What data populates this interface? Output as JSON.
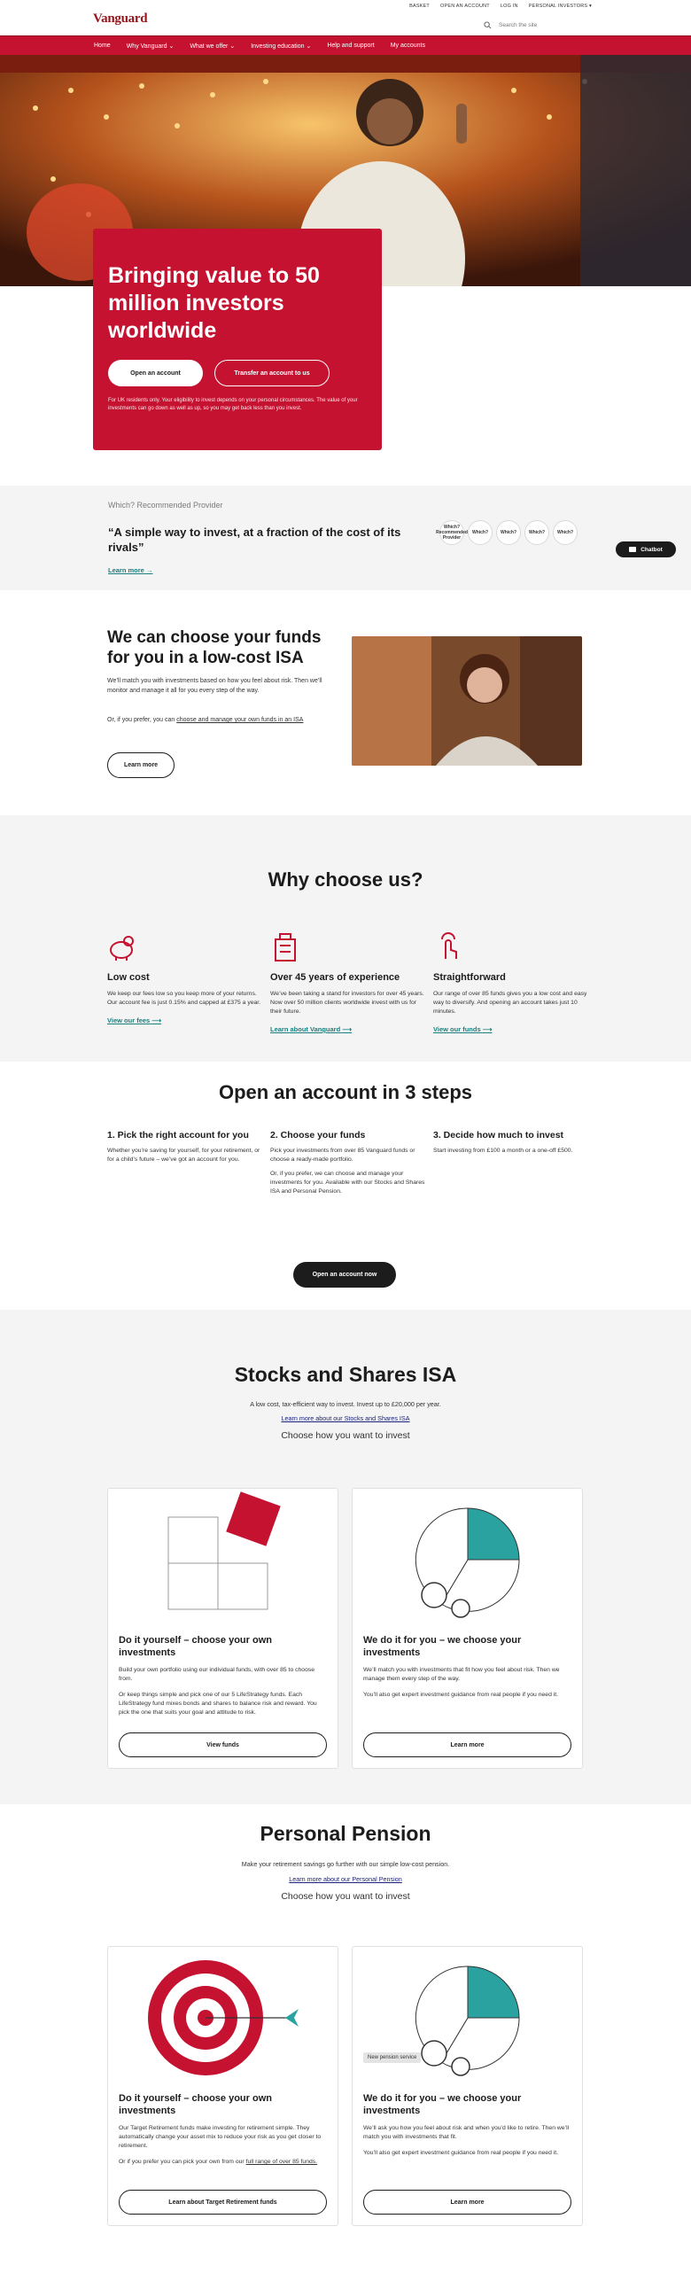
{
  "header": {
    "logo": "Vanguard",
    "top_links": [
      "Basket",
      "Open an account",
      "Log in",
      "Personal investors"
    ],
    "search_placeholder": "Search the site"
  },
  "nav": {
    "items": [
      "Home",
      "Why Vanguard",
      "What we offer",
      "Investing education",
      "Help and support",
      "My accounts"
    ]
  },
  "hero": {
    "title": "Bringing value to 50 million investors worldwide",
    "primary_button": "Open an account",
    "secondary_button": "Transfer an account to us",
    "disclaimer": "For UK residents only. Your eligibility to invest depends on your personal circumstances. The value of your investments can go down as well as up, so you may get back less than you invest."
  },
  "which": {
    "pre": "Which? Recommended Provider",
    "quote": "“A simple way to invest, at a fraction of the cost of its rivals”",
    "link": "Learn more",
    "badges": [
      "Which? Recommended Provider",
      "Which?",
      "Which?",
      "Which?",
      "Which?"
    ]
  },
  "chatbot": {
    "label": "Chatbot"
  },
  "isa": {
    "title": "We can choose your funds for you in a low-cost ISA",
    "p1": "We’ll match you with investments based on how you feel about risk. Then we’ll monitor and manage it all for you every step of the way.",
    "p2_prefix": "Or, if you prefer, you can ",
    "p2_link": "choose and manage your own funds in an ISA",
    "button": "Learn more"
  },
  "why": {
    "title": "Why choose us?",
    "cols": [
      {
        "title": "Low cost",
        "text": "We keep our fees low so you keep more of your returns. Our account fee is just 0.15% and capped at £375 a year.",
        "link": "View our fees"
      },
      {
        "title": "Over 45 years of experience",
        "text": "We’ve been taking a stand for investors for over 45 years. Now over 50 million clients worldwide invest with us for their future.",
        "link": "Learn about Vanguard"
      },
      {
        "title": "Straightforward",
        "text": "Our range of over 85 funds gives you a low cost and easy way to diversify. And opening an account takes just 10 minutes.",
        "link": "View our funds"
      }
    ]
  },
  "steps": {
    "title": "Open an account in 3 steps",
    "items": [
      {
        "title": "1. Pick the right account for you",
        "text": "Whether you’re saving for yourself, for your retirement, or for a child’s future – we’ve got an account for you.",
        "text2": ""
      },
      {
        "title": "2. Choose your funds",
        "text": "Pick your investments from over 85 Vanguard funds or choose a ready-made portfolio.",
        "text2": "Or, if you prefer, we can choose and manage your investments for you. Available with our Stocks and Shares ISA and Personal Pension."
      },
      {
        "title": "3. Decide how much to invest",
        "text": "Start investing from £100 a month or a one-off £500.",
        "text2": ""
      }
    ],
    "button": "Open an account now"
  },
  "stocks_isa": {
    "title": "Stocks and Shares ISA",
    "sub": "A low cost, tax-efficient way to invest. Invest up to £20,000 per year.",
    "link": "Learn more about our Stocks and Shares ISA",
    "choose": "Choose how you want to invest",
    "card1": {
      "title": "Do it yourself – choose your own investments",
      "p1": "Build your own portfolio using our individual funds, with over 85 to choose from.",
      "p2": "Or keep things simple and pick one of our 5 LifeStrategy funds. Each LifeStrategy fund mixes bonds and shares to balance risk and reward. You pick the one that suits your goal and attitude to risk.",
      "button": "View funds"
    },
    "card2": {
      "title": "We do it for you – we choose your investments",
      "p1": "We’ll match you with investments that fit how you feel about risk. Then we manage them every step of the way.",
      "p2": "You’ll also get expert investment guidance from real people if you need it.",
      "button": "Learn more"
    }
  },
  "pension": {
    "title": "Personal Pension",
    "sub": "Make your retirement savings go further with our simple low-cost pension.",
    "link": "Learn more about our Personal Pension",
    "choose": "Choose how you want to invest",
    "card1": {
      "title": "Do it yourself – choose your own investments",
      "p1": "Our Target Retirement funds make investing for retirement simple. They automatically change your asset mix to reduce your risk as you get closer to retirement.",
      "p2_prefix": "Or if you prefer you can pick your own from our ",
      "p2_link": "full range of over 85 funds.",
      "button": "Learn about Target Retirement funds"
    },
    "card2": {
      "tag": "New pension service",
      "title": "We do it for you – we choose your investments",
      "p1": "We’ll ask you how you feel about risk and when you’d like to retire. Then we’ll match you with investments that fit.",
      "p2": "You’ll also get expert investment guidance from real people if you need it.",
      "button": "Learn more"
    }
  },
  "colors": {
    "brand_red": "#c41230",
    "teal": "#1a7f7e",
    "dark": "#1c1c1c"
  }
}
